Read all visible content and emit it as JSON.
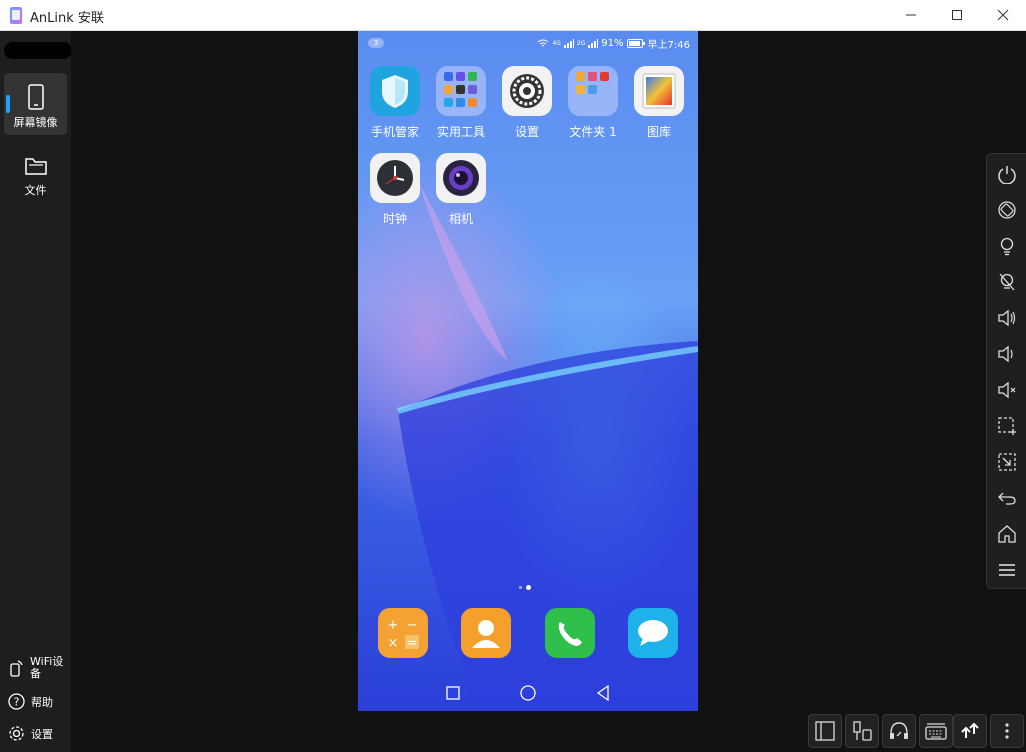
{
  "window": {
    "title": "AnLink 安联"
  },
  "sidebar": {
    "items": [
      {
        "label": "屏幕镜像",
        "icon": "phone-icon",
        "active": true
      },
      {
        "label": "文件",
        "icon": "folder-icon",
        "active": false
      }
    ],
    "bottom": [
      {
        "label": "WiFi设备",
        "icon": "wifi-device-icon"
      },
      {
        "label": "帮助",
        "icon": "help-icon"
      },
      {
        "label": "设置",
        "icon": "gear-icon"
      }
    ]
  },
  "phone": {
    "status": {
      "badge": "3",
      "signal1": "4G",
      "signal2": "2G",
      "battery": "91%",
      "time": "早上7:46"
    },
    "apps": [
      {
        "label": "手机管家",
        "icon": "phone-manager-icon"
      },
      {
        "label": "实用工具",
        "icon": "tools-folder-icon"
      },
      {
        "label": "设置",
        "icon": "settings-gear-icon"
      },
      {
        "label": "文件夹 1",
        "icon": "folder1-icon"
      },
      {
        "label": "图库",
        "icon": "gallery-icon"
      },
      {
        "label": "时钟",
        "icon": "clock-icon"
      },
      {
        "label": "相机",
        "icon": "camera-icon"
      }
    ],
    "dock": [
      "calculator-icon",
      "contacts-icon",
      "phone-call-icon",
      "messages-icon"
    ],
    "nav": [
      "recent-apps-button",
      "home-button",
      "back-button"
    ]
  },
  "toolbar": {
    "items": [
      "power-icon",
      "rotate-icon",
      "light-on-icon",
      "light-off-icon",
      "volume-up-icon",
      "volume-down-icon",
      "mute-icon",
      "screenshot-region-icon",
      "shrink-icon",
      "back-arrow-icon",
      "home-icon",
      "menu-icon"
    ]
  },
  "bottom_tools": [
    "layout-icon",
    "usb-icon",
    "headset-icon",
    "keyboard-icon",
    "transfer-icon",
    "more-icon"
  ],
  "colors": {
    "accent": "#1aa3ff",
    "sidebar": "#1e1e1e",
    "background": "#111111"
  }
}
